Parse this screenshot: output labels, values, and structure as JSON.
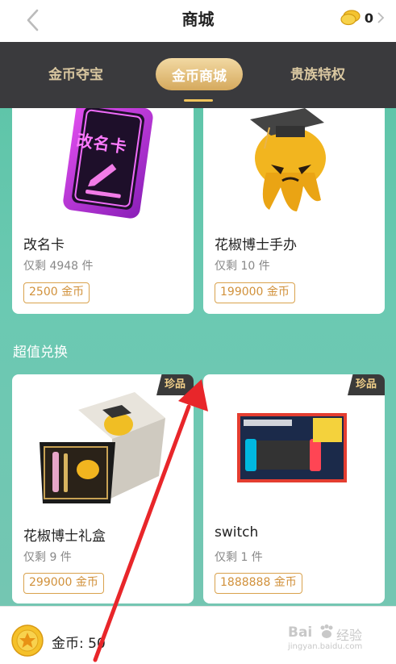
{
  "header": {
    "title": "商城",
    "coin_count": "0"
  },
  "tabs": [
    {
      "label": "金币夺宝",
      "active": false
    },
    {
      "label": "金币商城",
      "active": true
    },
    {
      "label": "贵族特权",
      "active": false
    }
  ],
  "top_items": [
    {
      "name": "改名卡",
      "stock": "仅剩 4948 件",
      "price": "2500 金币",
      "image_text": "改名卡"
    },
    {
      "name": "花椒博士手办",
      "stock": "仅剩 10 件",
      "price": "199000 金币"
    }
  ],
  "section_title": "超值兑换",
  "exchange_items": [
    {
      "name": "花椒博士礼盒",
      "stock": "仅剩 9 件",
      "price": "299000 金币",
      "badge": "珍品"
    },
    {
      "name": "switch",
      "stock": "仅剩 1 件",
      "price": "1888888 金币",
      "badge": "珍品"
    }
  ],
  "footer": {
    "coins_label": "金币: 50"
  },
  "watermark": {
    "brand": "Bai",
    "brand_suffix": "经验",
    "url": "jingyan.baidu.com"
  },
  "colors": {
    "tabbar_bg": "#3a3a3d",
    "tab_text": "#d9c7a0",
    "active_tab": "#d5a95d",
    "content_bg": "#5fc5a9",
    "price_border": "#d9a24d",
    "arrow": "#e8262a"
  }
}
